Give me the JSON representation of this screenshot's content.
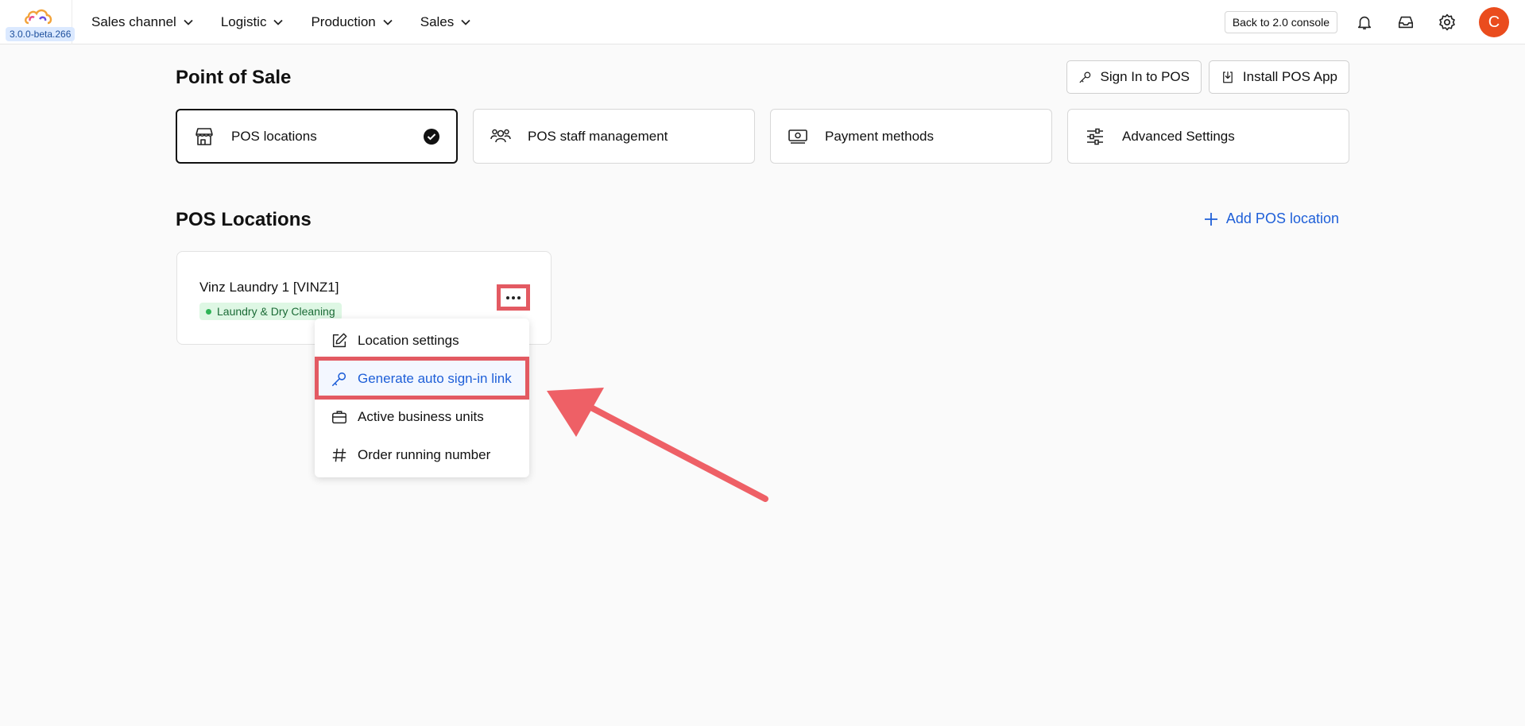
{
  "app": {
    "version": "3.0.0-beta.266",
    "avatar_initial": "C",
    "back_console_label": "Back to 2.0 console"
  },
  "nav": {
    "items": [
      {
        "label": "Sales channel"
      },
      {
        "label": "Logistic"
      },
      {
        "label": "Production"
      },
      {
        "label": "Sales"
      }
    ]
  },
  "header": {
    "title": "Point of Sale",
    "sign_in_label": "Sign In to POS",
    "install_label": "Install POS App"
  },
  "tabs": [
    {
      "label": "POS locations",
      "icon": "store-icon",
      "active": true
    },
    {
      "label": "POS staff management",
      "icon": "users-icon",
      "active": false
    },
    {
      "label": "Payment methods",
      "icon": "money-icon",
      "active": false
    },
    {
      "label": "Advanced Settings",
      "icon": "sliders-icon",
      "active": false
    }
  ],
  "locations_section": {
    "title": "POS Locations",
    "add_label": "Add POS location"
  },
  "location_card": {
    "name": "Vinz Laundry 1 [VINZ1]",
    "tag": "Laundry & Dry Cleaning"
  },
  "menu": {
    "items": [
      {
        "label": "Location settings",
        "icon": "edit-icon"
      },
      {
        "label": "Generate auto sign-in link",
        "icon": "key-icon",
        "highlighted": true
      },
      {
        "label": "Active business units",
        "icon": "briefcase-icon"
      },
      {
        "label": "Order running number",
        "icon": "hash-icon"
      }
    ]
  },
  "colors": {
    "accent": "#1e5fd8",
    "annotation": "#e35a62",
    "avatar": "#ea4c1d",
    "tag_bg": "#def7e4"
  }
}
